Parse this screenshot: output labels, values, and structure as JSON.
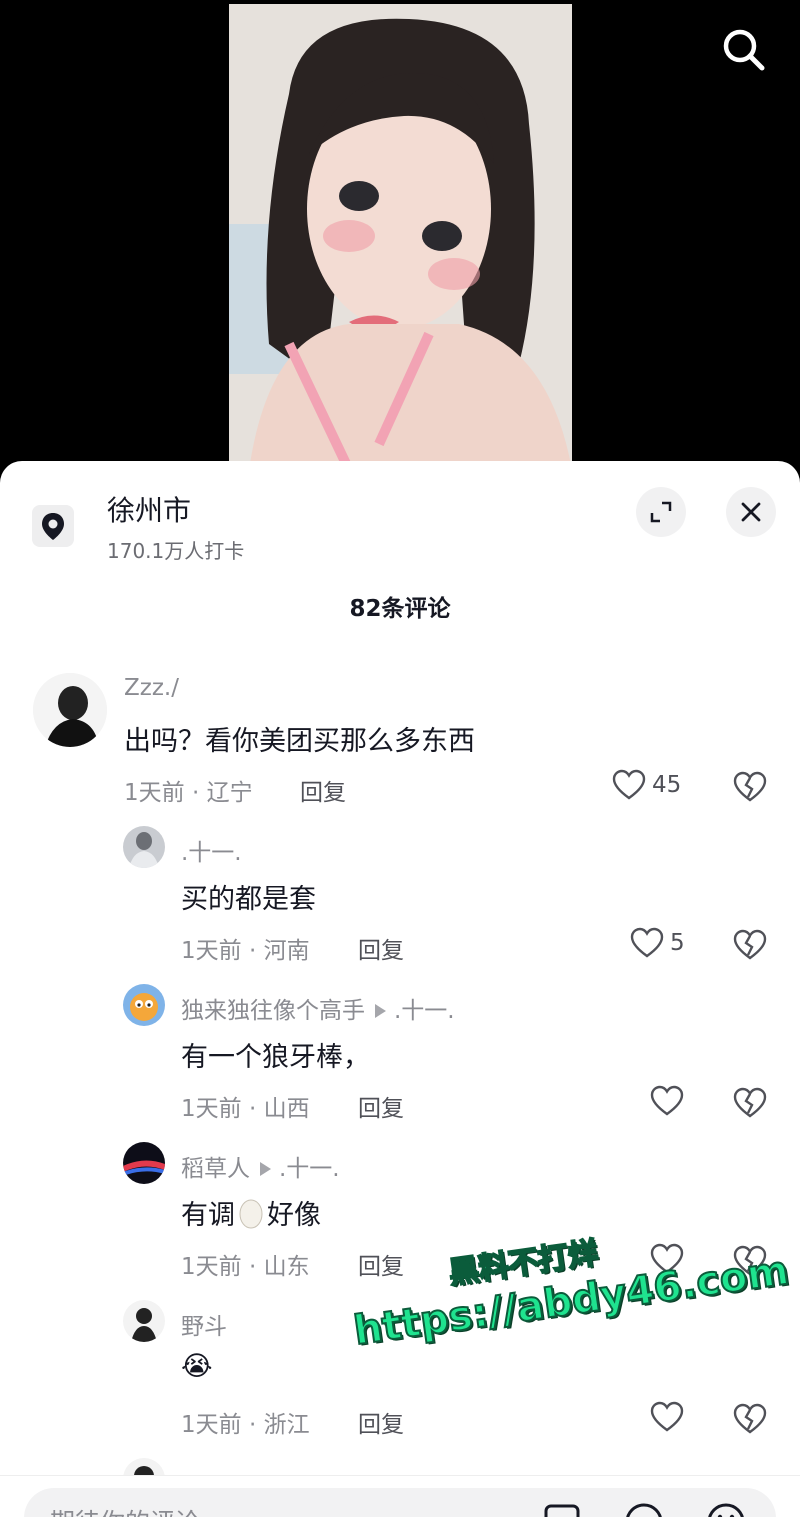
{
  "location": {
    "name": "徐州市",
    "checkins": "170.1万人打卡"
  },
  "comments_count": "82条评论",
  "comments": [
    {
      "user": "Zzz./",
      "text": "出吗？看你美团买那么多东西",
      "time": "1天前 · 辽宁",
      "reply": "回复",
      "likes": "45"
    },
    {
      "user": ".十一.",
      "text": "买的都是套",
      "time": "1天前 · 河南",
      "reply": "回复",
      "likes": "5"
    },
    {
      "user": "独来独往像个高手",
      "reply_to": ".十一.",
      "text": "有一个狼牙棒，",
      "time": "1天前 · 山西",
      "reply": "回复",
      "likes": ""
    },
    {
      "user": "稻草人",
      "reply_to": ".十一.",
      "text_before": "有调",
      "text_after": "好像",
      "time": "1天前 · 山东",
      "reply": "回复",
      "likes": ""
    },
    {
      "user": "野斗",
      "text": "😭",
      "time": "1天前 · 浙江",
      "reply": "回复",
      "likes": ""
    }
  ],
  "input": {
    "placeholder": "期待你的评论"
  },
  "watermark": {
    "line1": "黑料不打烊",
    "line2": "https://abdy46.com"
  },
  "icons": [
    "search-icon",
    "location-pin-icon",
    "expand-icon",
    "close-icon",
    "heart-icon",
    "broken-heart-icon",
    "image-icon",
    "at-icon",
    "emoji-icon"
  ]
}
